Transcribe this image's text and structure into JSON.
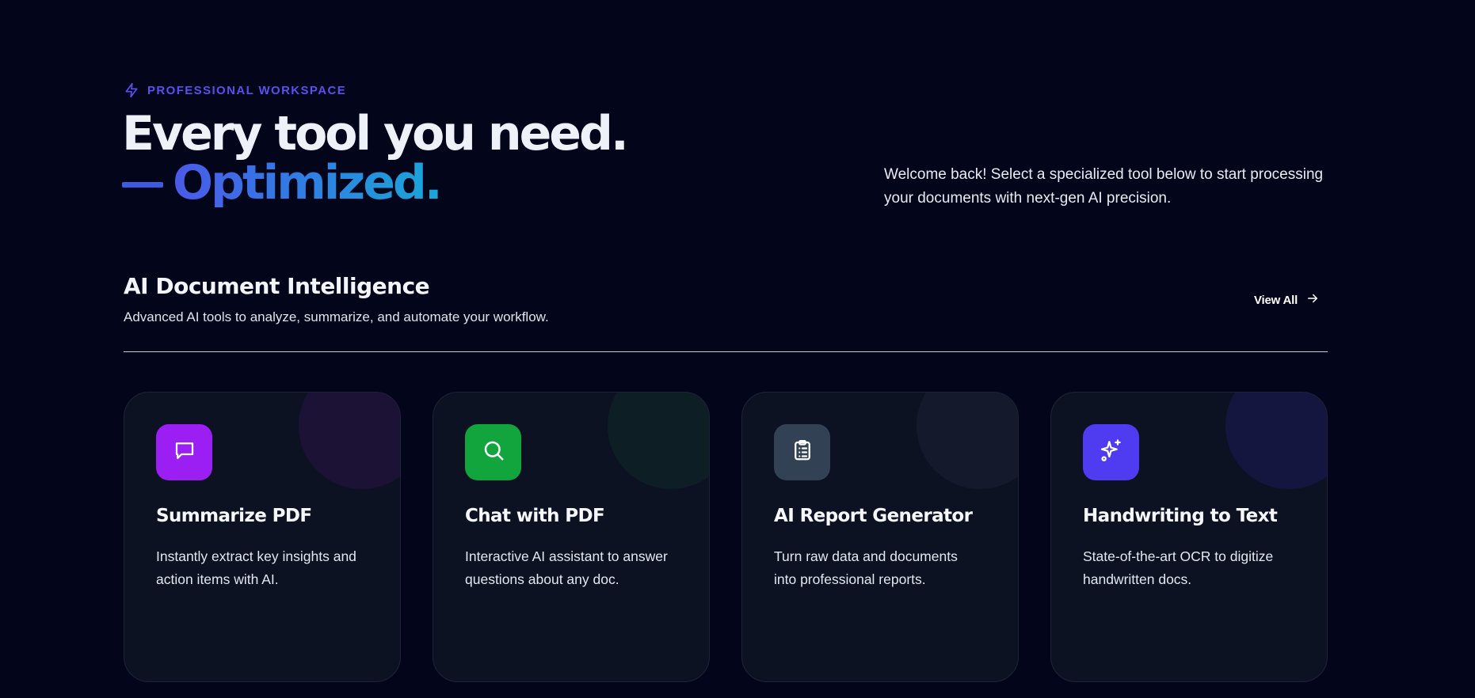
{
  "header": {
    "eyebrow": "PROFESSIONAL WORKSPACE",
    "eyebrow_icon": "lightning-icon",
    "title_line1": "Every tool you need.",
    "title_line2": "Optimized.",
    "welcome": "Welcome back! Select a specialized tool below to start processing your documents with next-gen AI precision."
  },
  "section": {
    "title": "AI Document Intelligence",
    "subtitle": "Advanced AI tools to analyze, summarize, and automate your workflow.",
    "view_all": "View All"
  },
  "cards": [
    {
      "title": "Summarize PDF",
      "description": "Instantly extract key insights and action items with AI.",
      "icon": "chat-bubble-icon",
      "icon_color": "#9b1ff2",
      "blob_color": "#1c1236"
    },
    {
      "title": "Chat with PDF",
      "description": "Interactive AI assistant to answer questions about any doc.",
      "icon": "search-icon",
      "icon_color": "#12a53e",
      "blob_color": "#0d1f24"
    },
    {
      "title": "AI Report Generator",
      "description": "Turn raw data and documents into professional reports.",
      "icon": "clipboard-icon",
      "icon_color": "#334155",
      "blob_color": "#141a2b"
    },
    {
      "title": "Handwriting to Text",
      "description": "State-of-the-art OCR to digitize handwritten docs.",
      "icon": "sparkles-icon",
      "icon_color": "#4f3bf0",
      "blob_color": "#151640"
    }
  ]
}
